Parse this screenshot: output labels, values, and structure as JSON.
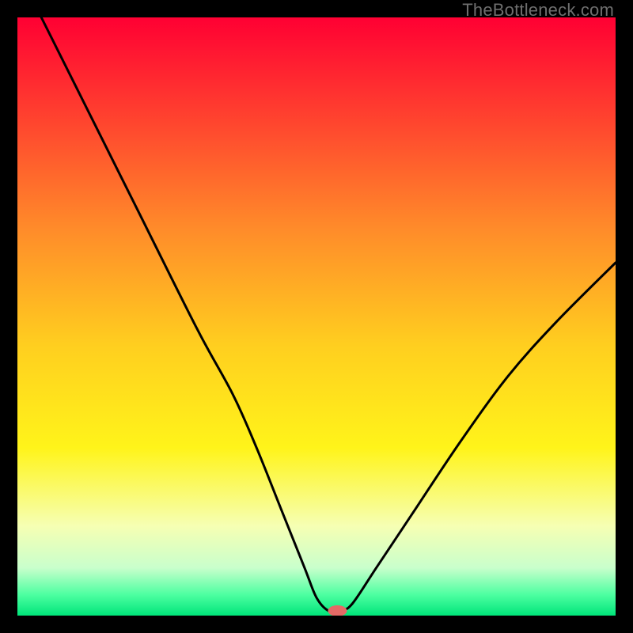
{
  "watermark": "TheBottleneck.com",
  "chart_data": {
    "type": "line",
    "title": "",
    "xlabel": "",
    "ylabel": "",
    "xlim": [
      0,
      100
    ],
    "ylim": [
      0,
      100
    ],
    "grid": false,
    "curve": {
      "description": "Bottleneck curve with minimum near x≈53",
      "x": [
        4,
        10,
        20,
        30,
        36,
        40,
        44,
        48,
        50,
        52,
        54,
        56,
        60,
        66,
        74,
        82,
        90,
        100
      ],
      "y": [
        100,
        88,
        68,
        48,
        37,
        28,
        18,
        8,
        3,
        0.8,
        0.8,
        2,
        8,
        17,
        29,
        40,
        49,
        59
      ]
    },
    "gradient_stops": [
      {
        "offset": 0.0,
        "color": "#ff0033"
      },
      {
        "offset": 0.15,
        "color": "#ff3b2f"
      },
      {
        "offset": 0.35,
        "color": "#ff8a2a"
      },
      {
        "offset": 0.55,
        "color": "#ffcf1f"
      },
      {
        "offset": 0.72,
        "color": "#fff41a"
      },
      {
        "offset": 0.85,
        "color": "#f6ffb3"
      },
      {
        "offset": 0.92,
        "color": "#c9ffcc"
      },
      {
        "offset": 0.965,
        "color": "#4dffa1"
      },
      {
        "offset": 1.0,
        "color": "#00e57a"
      }
    ],
    "marker": {
      "x": 53.5,
      "y": 0.8,
      "color": "#e46a66",
      "rx": 12,
      "ry": 7
    }
  }
}
